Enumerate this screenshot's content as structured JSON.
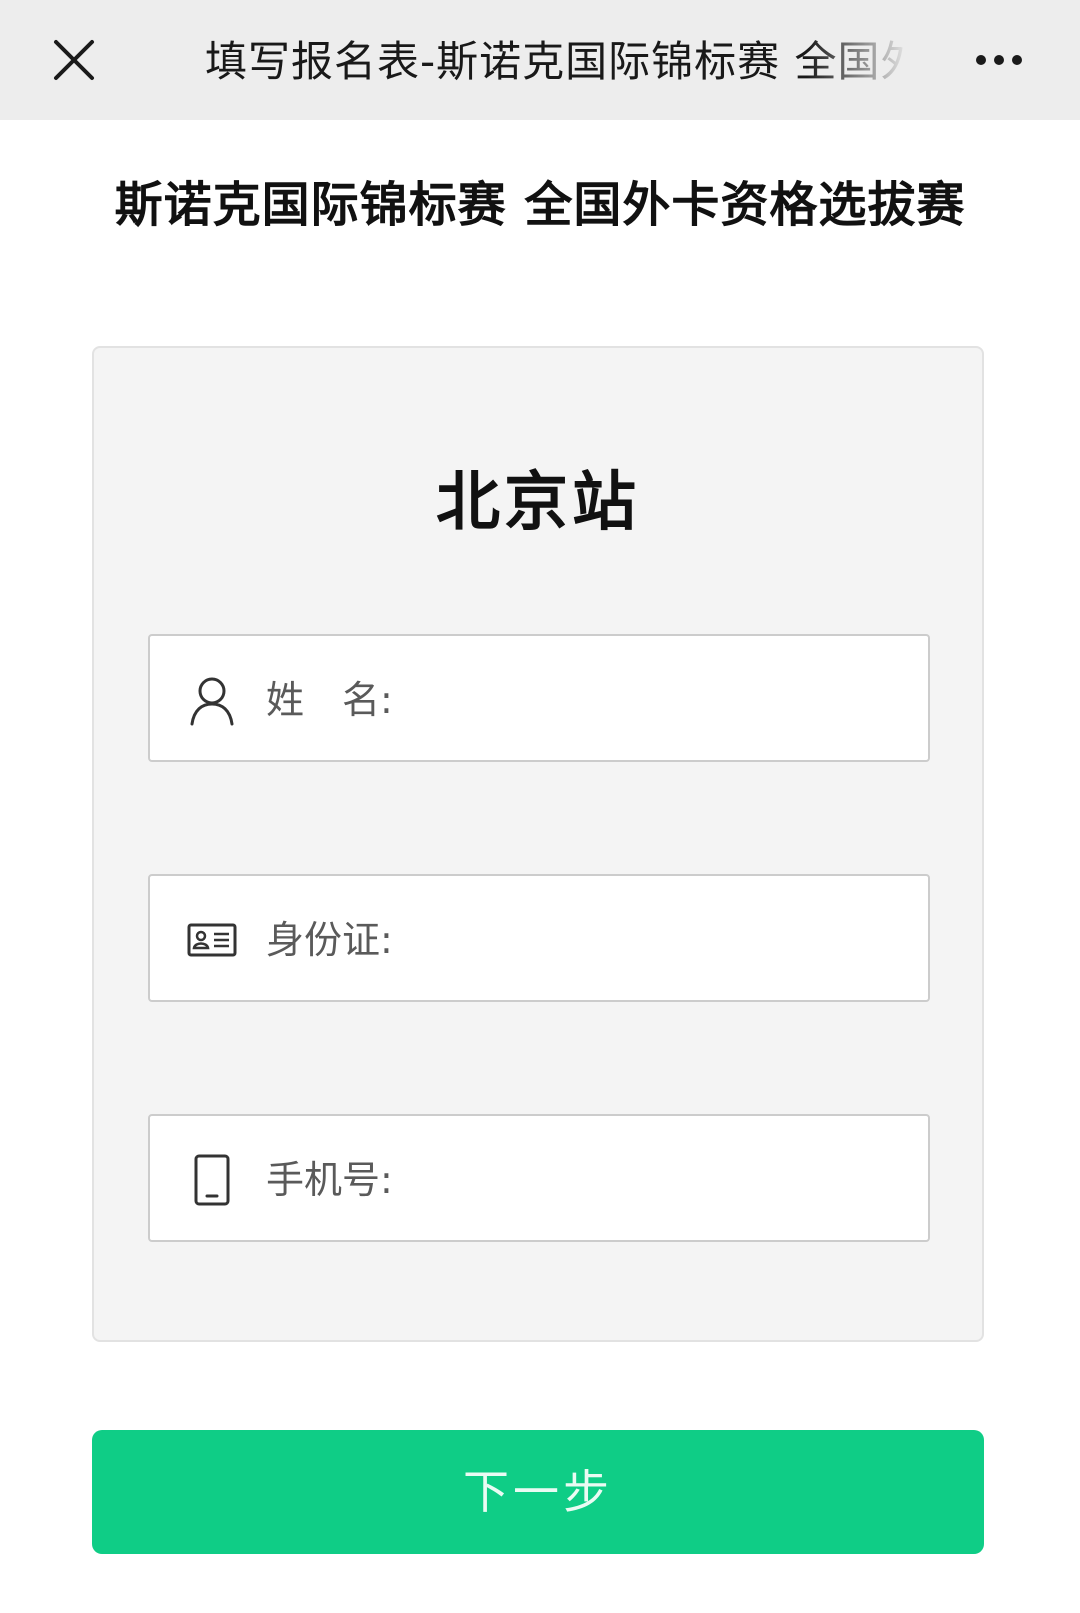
{
  "nav": {
    "title": "填写报名表-斯诺克国际锦标赛 全国外卡资格选拔赛",
    "close_icon": "close-icon",
    "more_icon": "more-dots-icon"
  },
  "page": {
    "heading": "斯诺克国际锦标赛 全国外卡资格选拔赛"
  },
  "form": {
    "station": "北京站",
    "fields": [
      {
        "icon": "person-icon",
        "label": "姓　名:",
        "value": ""
      },
      {
        "icon": "id-card-icon",
        "label": "身份证:",
        "value": ""
      },
      {
        "icon": "phone-icon",
        "label": "手机号:",
        "value": ""
      }
    ]
  },
  "actions": {
    "next_label": "下一步"
  },
  "colors": {
    "nav_bg": "#ededed",
    "card_bg": "#f4f4f4",
    "primary_green": "#0fcd86"
  }
}
